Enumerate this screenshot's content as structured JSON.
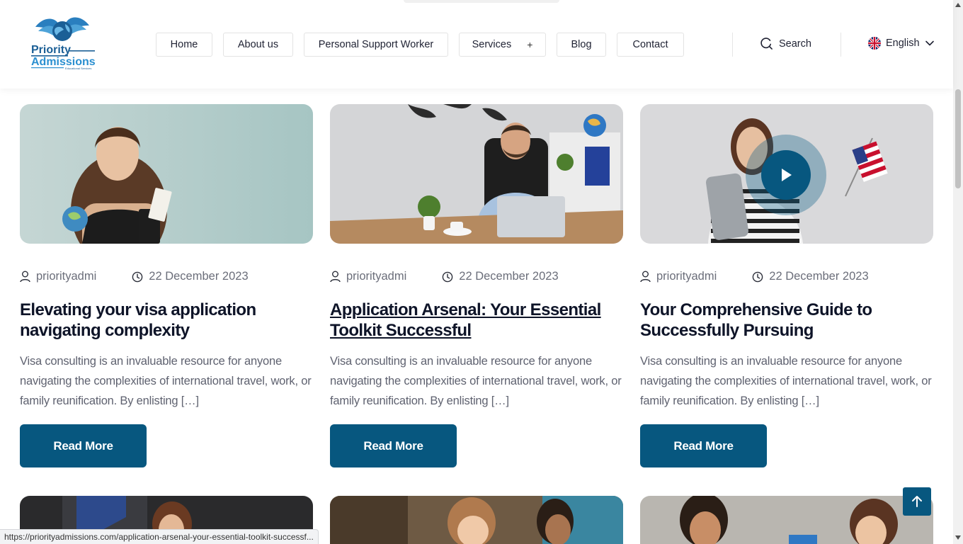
{
  "brand": {
    "name_line1": "Priority",
    "name_line2": "Admissions",
    "tagline": "Educational Services"
  },
  "nav": {
    "items": [
      {
        "label": "Home"
      },
      {
        "label": "About us"
      },
      {
        "label": "Personal Support Worker"
      },
      {
        "label": "Services",
        "has_submenu": true
      },
      {
        "label": "Blog"
      },
      {
        "label": "Contact"
      }
    ],
    "plus_symbol": "+"
  },
  "search": {
    "label": "Search"
  },
  "language": {
    "label": "English"
  },
  "posts": [
    {
      "author": "priorityadmi",
      "date": "22 December 2023",
      "title": "Elevating your visa application navigating complexity",
      "excerpt": "Visa consulting is an invaluable resource for anyone navigating the complexities of international travel, work, or family reunification. By enlisting […]",
      "button": "Read More"
    },
    {
      "author": "priorityadmi",
      "date": "22 December 2023",
      "title": "Application Arsenal: Your Essential Toolkit Successful",
      "excerpt": "Visa consulting is an invaluable resource for anyone navigating the complexities of international travel, work, or family reunification. By enlisting […]",
      "button": "Read More"
    },
    {
      "author": "priorityadmi",
      "date": "22 December 2023",
      "title": "Your Comprehensive Guide to Successfully Pursuing",
      "excerpt": "Visa consulting is an invaluable resource for anyone navigating the complexities of international travel, work, or family reunification. By enlisting […]",
      "button": "Read More"
    }
  ],
  "status_bar": {
    "url": "https://priorityadmissions.com/application-arsenal-your-essential-toolkit-successf..."
  },
  "colors": {
    "accent": "#07577f",
    "heading": "#0e1428",
    "muted": "#6b6e7a"
  }
}
